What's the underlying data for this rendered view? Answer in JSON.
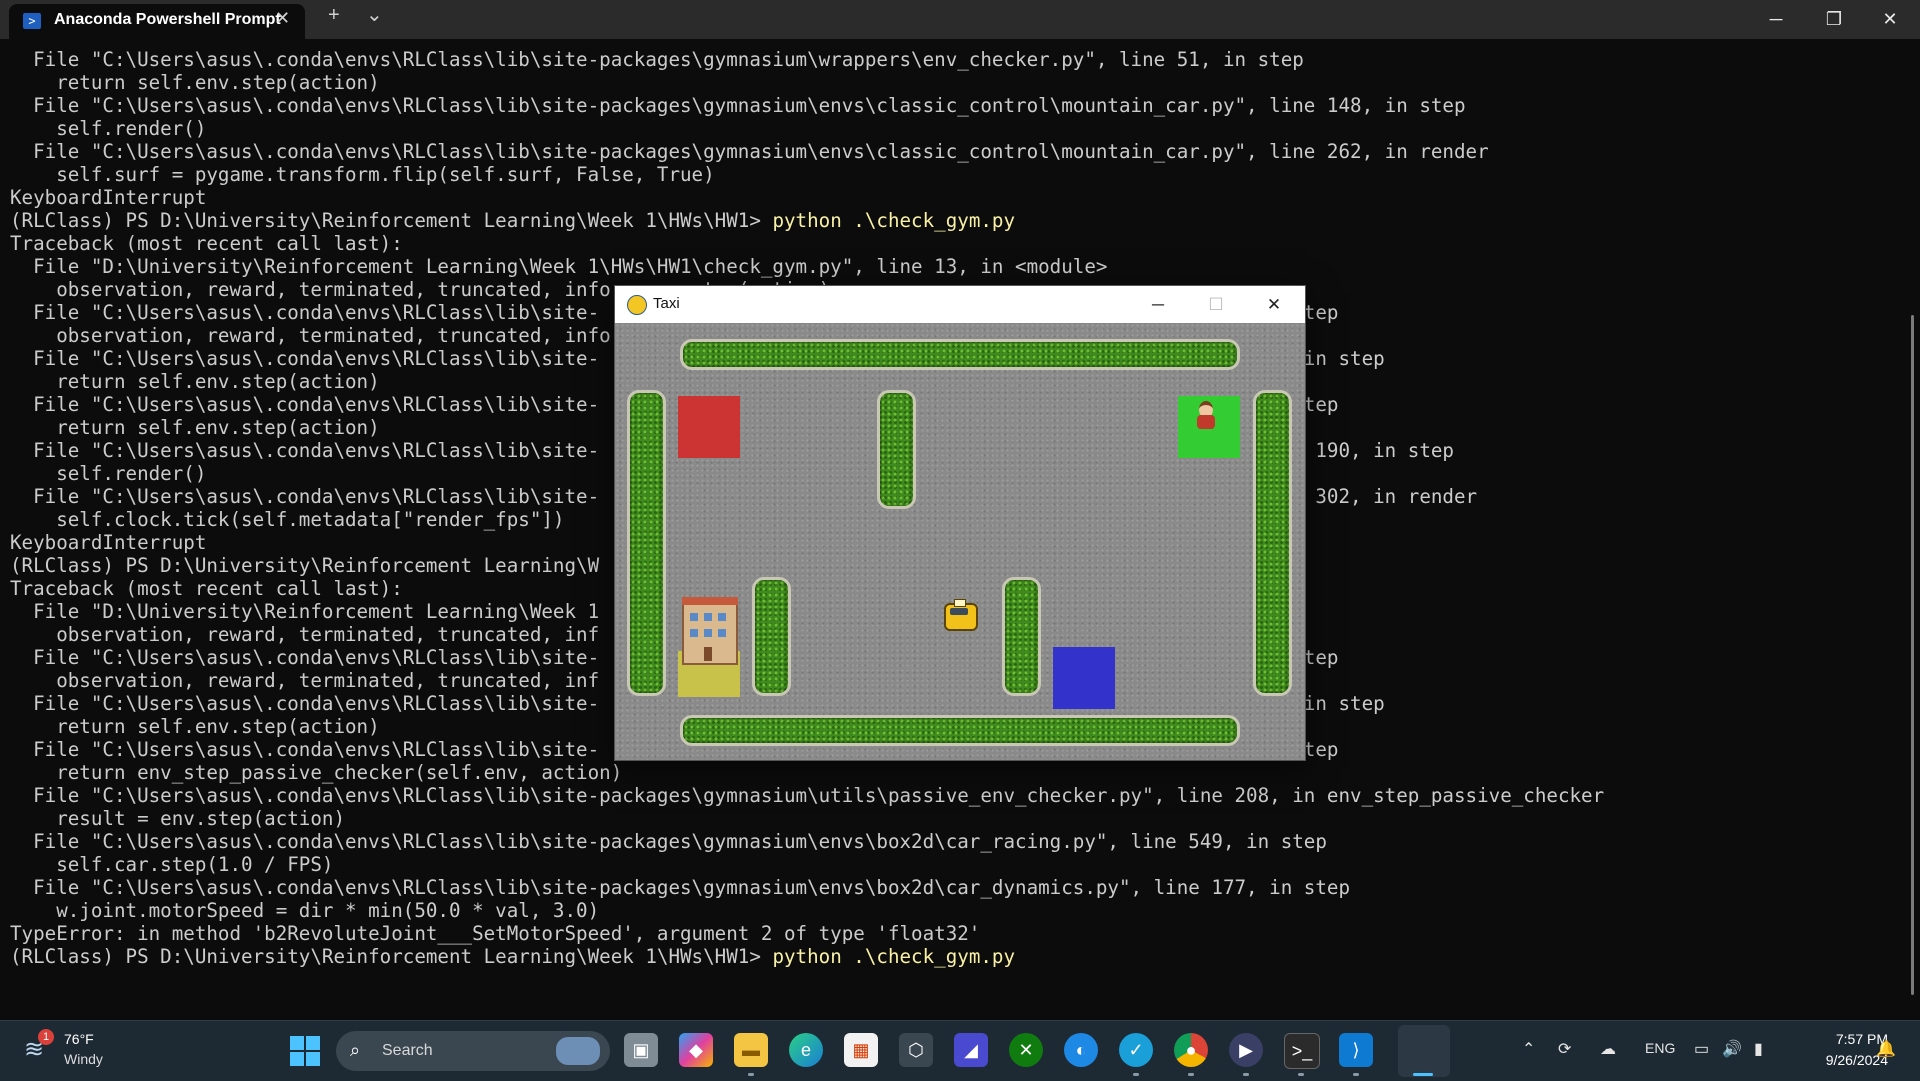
{
  "terminal": {
    "tab_title": "Anaconda Powershell Prompt",
    "new_tab": "+",
    "dropdown": "⌄",
    "lines": [
      {
        "text": "  File \"C:\\Users\\asus\\.conda\\envs\\RLClass\\lib\\site-packages\\gymnasium\\wrappers\\env_checker.py\", line 51, in step"
      },
      {
        "text": "    return self.env.step(action)"
      },
      {
        "text": "  File \"C:\\Users\\asus\\.conda\\envs\\RLClass\\lib\\site-packages\\gymnasium\\envs\\classic_control\\mountain_car.py\", line 148, in step"
      },
      {
        "text": "    self.render()"
      },
      {
        "text": "  File \"C:\\Users\\asus\\.conda\\envs\\RLClass\\lib\\site-packages\\gymnasium\\envs\\classic_control\\mountain_car.py\", line 262, in render"
      },
      {
        "text": "    self.surf = pygame.transform.flip(self.surf, False, True)"
      },
      {
        "text": "KeyboardInterrupt"
      },
      {
        "text": "(RLClass) PS D:\\University\\Reinforcement Learning\\Week 1\\HWs\\HW1> ",
        "cmd": "python .\\check_gym.py"
      },
      {
        "text": "Traceback (most recent call last):"
      },
      {
        "text": "  File \"D:\\University\\Reinforcement Learning\\Week 1\\HWs\\HW1\\check_gym.py\", line 13, in <module>"
      },
      {
        "text": "    observation, reward, terminated, truncated, info = env.step(action)"
      },
      {
        "text": "  File \"C:\\Users\\asus\\.conda\\envs\\RLClass\\lib\\site-                                                            step"
      },
      {
        "text": "    observation, reward, terminated, truncated, info"
      },
      {
        "text": "  File \"C:\\Users\\asus\\.conda\\envs\\RLClass\\lib\\site-                                                             in step"
      },
      {
        "text": "    return self.env.step(action)"
      },
      {
        "text": "  File \"C:\\Users\\asus\\.conda\\envs\\RLClass\\lib\\site-                                                            step"
      },
      {
        "text": "    return self.env.step(action)"
      },
      {
        "text": "  File \"C:\\Users\\asus\\.conda\\envs\\RLClass\\lib\\site-                                                            e 190, in step"
      },
      {
        "text": "    self.render()"
      },
      {
        "text": "  File \"C:\\Users\\asus\\.conda\\envs\\RLClass\\lib\\site-                                                            e 302, in render"
      },
      {
        "text": "    self.clock.tick(self.metadata[\"render_fps\"])"
      },
      {
        "text": "KeyboardInterrupt"
      },
      {
        "text": "(RLClass) PS D:\\University\\Reinforcement Learning\\W"
      },
      {
        "text": "Traceback (most recent call last):"
      },
      {
        "text": "  File \"D:\\University\\Reinforcement Learning\\Week 1"
      },
      {
        "text": "    observation, reward, terminated, truncated, inf"
      },
      {
        "text": "  File \"C:\\Users\\asus\\.conda\\envs\\RLClass\\lib\\site-                                                            step"
      },
      {
        "text": "    observation, reward, terminated, truncated, inf"
      },
      {
        "text": "  File \"C:\\Users\\asus\\.conda\\envs\\RLClass\\lib\\site-                                                             in step"
      },
      {
        "text": "    return self.env.step(action)"
      },
      {
        "text": "  File \"C:\\Users\\asus\\.conda\\envs\\RLClass\\lib\\site-                                                            step"
      },
      {
        "text": "    return env_step_passive_checker(self.env, action)"
      },
      {
        "text": "  File \"C:\\Users\\asus\\.conda\\envs\\RLClass\\lib\\site-packages\\gymnasium\\utils\\passive_env_checker.py\", line 208, in env_step_passive_checker"
      },
      {
        "text": "    result = env.step(action)"
      },
      {
        "text": "  File \"C:\\Users\\asus\\.conda\\envs\\RLClass\\lib\\site-packages\\gymnasium\\envs\\box2d\\car_racing.py\", line 549, in step"
      },
      {
        "text": "    self.car.step(1.0 / FPS)"
      },
      {
        "text": "  File \"C:\\Users\\asus\\.conda\\envs\\RLClass\\lib\\site-packages\\gymnasium\\envs\\box2d\\car_dynamics.py\", line 177, in step"
      },
      {
        "text": "    w.joint.motorSpeed = dir * min(50.0 * val, 3.0)"
      },
      {
        "text": "TypeError: in method 'b2RevoluteJoint___SetMotorSpeed', argument 2 of type 'float32'"
      },
      {
        "text": "(RLClass) PS D:\\University\\Reinforcement Learning\\Week 1\\HWs\\HW1> ",
        "cmd": "python .\\check_gym.py"
      }
    ]
  },
  "taxi_window": {
    "title": "Taxi",
    "locations": [
      {
        "name": "red",
        "color": "#cc3333"
      },
      {
        "name": "green",
        "color": "#33cc33"
      },
      {
        "name": "yellow",
        "color": "#c8c24a"
      },
      {
        "name": "blue",
        "color": "#3333cc"
      }
    ]
  },
  "taskbar": {
    "weather": {
      "badge": "1",
      "temp": "76°F",
      "condition": "Windy"
    },
    "search_placeholder": "Search",
    "tray": {
      "language": "ENG",
      "time": "7:57 PM",
      "date": "9/26/2024"
    }
  },
  "colors": {
    "terminal_bg": "#0c0c0c",
    "terminal_fg": "#cccccc",
    "command": "#f9f1a5",
    "taskbar_bg": "#1e2a33"
  }
}
